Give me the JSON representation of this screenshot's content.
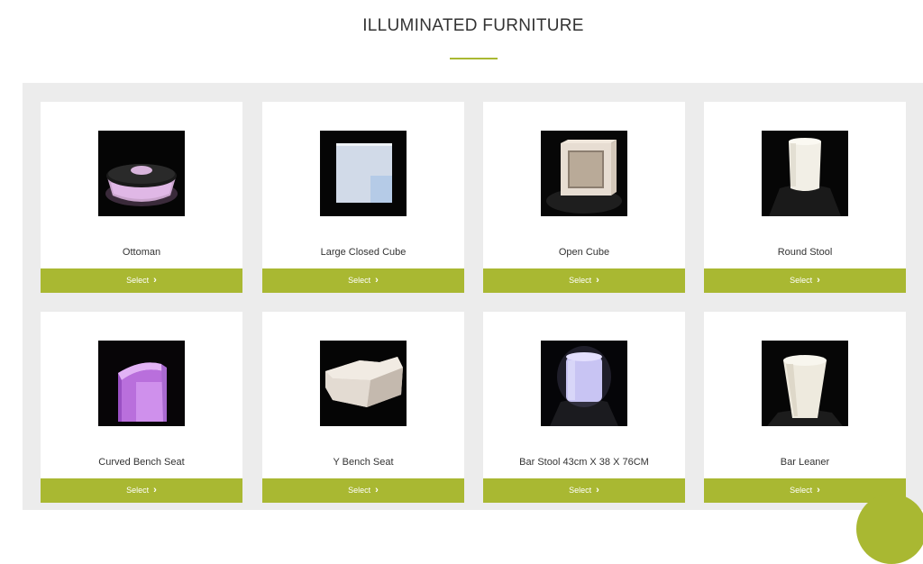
{
  "page": {
    "title": "ILLUMINATED FURNITURE",
    "accent_color": "#a9b832",
    "grid_background": "#ececec"
  },
  "products": [
    {
      "name": "Ottoman",
      "select_label": "Select",
      "image_icon": "ottoman-image"
    },
    {
      "name": "Large Closed Cube",
      "select_label": "Select",
      "image_icon": "large-closed-cube-image"
    },
    {
      "name": "Open Cube",
      "select_label": "Select",
      "image_icon": "open-cube-image"
    },
    {
      "name": "Round Stool",
      "select_label": "Select",
      "image_icon": "round-stool-image"
    },
    {
      "name": "Curved Bench Seat",
      "select_label": "Select",
      "image_icon": "curved-bench-seat-image"
    },
    {
      "name": "Y Bench Seat",
      "select_label": "Select",
      "image_icon": "y-bench-seat-image"
    },
    {
      "name": "Bar Stool 43cm X 38 X 76CM",
      "select_label": "Select",
      "image_icon": "bar-stool-image"
    },
    {
      "name": "Bar Leaner",
      "select_label": "Select",
      "image_icon": "bar-leaner-image"
    }
  ],
  "chevron_icon": "chevron-right-icon",
  "floating_button_icon": "chat-bubble-icon"
}
